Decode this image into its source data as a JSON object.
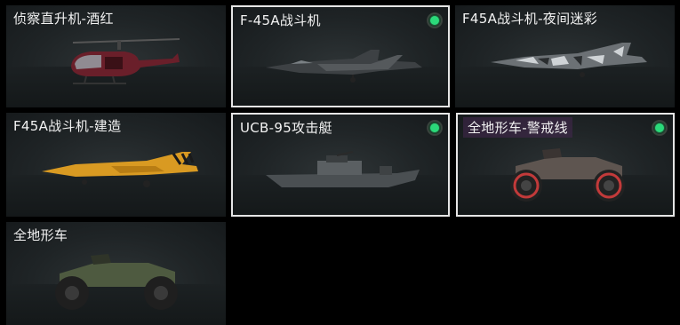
{
  "items": [
    {
      "label": "侦察直升机-酒红",
      "owned": false,
      "selected": false,
      "icon": "helicopter-icon"
    },
    {
      "label": "F-45A战斗机",
      "owned": true,
      "selected": true,
      "icon": "jet-icon"
    },
    {
      "label": "F45A战斗机-夜间迷彩",
      "owned": false,
      "selected": false,
      "icon": "jet-camo-icon"
    },
    {
      "label": "F45A战斗机-建造",
      "owned": false,
      "selected": false,
      "icon": "jet-yellow-icon"
    },
    {
      "label": "UCB-95攻击艇",
      "owned": true,
      "selected": true,
      "icon": "boat-icon"
    },
    {
      "label": "全地形车-警戒线",
      "owned": true,
      "selected": true,
      "icon": "atv-icon"
    },
    {
      "label": "全地形车",
      "owned": false,
      "selected": false,
      "icon": "atv-green-icon"
    }
  ],
  "colors": {
    "owned_dot": "#2bd97a",
    "selected_border": "#e6e6e6"
  }
}
